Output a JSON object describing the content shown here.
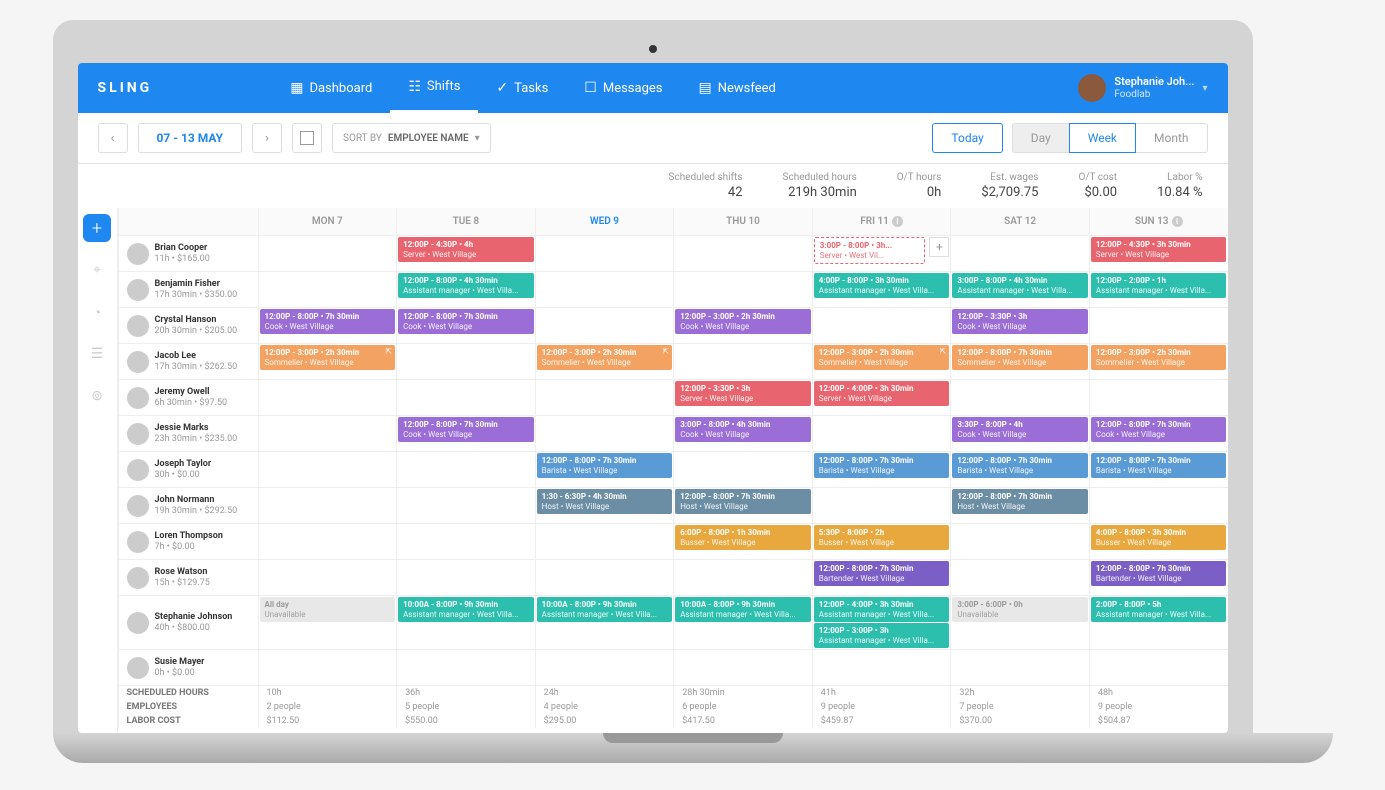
{
  "brand": "SLING",
  "nav": [
    {
      "label": "Dashboard",
      "icon": "▦"
    },
    {
      "label": "Shifts",
      "icon": "☷",
      "active": true
    },
    {
      "label": "Tasks",
      "icon": "✓"
    },
    {
      "label": "Messages",
      "icon": "☐"
    },
    {
      "label": "Newsfeed",
      "icon": "▤"
    }
  ],
  "user": {
    "name": "Stephanie Joh...",
    "org": "Foodlab"
  },
  "dateRange": "07 - 13 MAY",
  "sort": {
    "label": "SORT BY",
    "value": "EMPLOYEE NAME"
  },
  "viewButtons": {
    "today": "Today",
    "day": "Day",
    "week": "Week",
    "month": "Month"
  },
  "stats": [
    {
      "label": "Scheduled shifts",
      "value": "42"
    },
    {
      "label": "Scheduled hours",
      "value": "219h 30min"
    },
    {
      "label": "O/T hours",
      "value": "0h"
    },
    {
      "label": "Est. wages",
      "value": "$2,709.75"
    },
    {
      "label": "O/T cost",
      "value": "$0.00"
    },
    {
      "label": "Labor %",
      "value": "10.84 %"
    }
  ],
  "days": [
    {
      "label": "MON 7"
    },
    {
      "label": "TUE 8"
    },
    {
      "label": "WED 9",
      "today": true
    },
    {
      "label": "THU 10"
    },
    {
      "label": "FRI 11",
      "info": true
    },
    {
      "label": "SAT 12"
    },
    {
      "label": "SUN 13",
      "info": true
    }
  ],
  "employees": [
    {
      "name": "Brian Cooper",
      "meta": "11h • $165.00",
      "shifts": {
        "1": [
          {
            "c": "red",
            "t": "12:00P - 4:30P • 4h",
            "r": "Server • West Village"
          }
        ],
        "4": [
          {
            "c": "outlined",
            "t": "3:00P - 8:00P • 3h...",
            "r": "Server • West Vil...",
            "add": true
          }
        ],
        "6": [
          {
            "c": "red",
            "t": "12:00P - 4:30P • 3h 30min",
            "r": "Server • West Village"
          }
        ]
      }
    },
    {
      "name": "Benjamin Fisher",
      "meta": "17h 30min • $350.00",
      "shifts": {
        "1": [
          {
            "c": "teal",
            "t": "12:00P - 8:00P • 4h 30min",
            "r": "Assistant manager • West Villa..."
          }
        ],
        "4": [
          {
            "c": "teal",
            "t": "4:00P - 8:00P • 3h 30min",
            "r": "Assistant manager • West Villa..."
          }
        ],
        "5": [
          {
            "c": "teal",
            "t": "3:00P - 8:00P • 4h 30min",
            "r": "Assistant manager • West Villa..."
          }
        ],
        "6": [
          {
            "c": "teal",
            "t": "12:00P - 2:00P • 1h",
            "r": "Assistant manager • West Villa..."
          }
        ]
      }
    },
    {
      "name": "Crystal Hanson",
      "meta": "20h 30min • $205.00",
      "shifts": {
        "0": [
          {
            "c": "purple",
            "t": "12:00P - 8:00P • 7h 30min",
            "r": "Cook • West Village"
          }
        ],
        "1": [
          {
            "c": "purple",
            "t": "12:00P - 8:00P • 7h 30min",
            "r": "Cook • West Village"
          }
        ],
        "3": [
          {
            "c": "purple",
            "t": "12:00P - 3:00P • 2h 30min",
            "r": "Cook • West Village"
          }
        ],
        "5": [
          {
            "c": "purple",
            "t": "12:00P - 3:30P • 3h",
            "r": "Cook • West Village"
          }
        ]
      }
    },
    {
      "name": "Jacob Lee",
      "meta": "17h 30min • $262.50",
      "shifts": {
        "0": [
          {
            "c": "orange",
            "t": "12:00P - 3:00P • 2h 30min",
            "r": "Sommelier • West Village",
            "ext": true
          }
        ],
        "2": [
          {
            "c": "orange",
            "t": "12:00P - 3:00P • 2h 30min",
            "r": "Sommelier • West Village",
            "ext": true
          }
        ],
        "4": [
          {
            "c": "orange",
            "t": "12:00P - 3:00P • 2h 30min",
            "r": "Sommelier • West Village",
            "ext": true
          }
        ],
        "5": [
          {
            "c": "orange",
            "t": "12:00P - 8:00P • 7h 30min",
            "r": "Sommelier • West Village"
          }
        ],
        "6": [
          {
            "c": "orange",
            "t": "12:00P - 3:00P • 2h 30min",
            "r": "Sommelier • West Village"
          }
        ]
      }
    },
    {
      "name": "Jeremy Owell",
      "meta": "6h 30min • $97.50",
      "shifts": {
        "3": [
          {
            "c": "red",
            "t": "12:00P - 3:30P • 3h",
            "r": "Server • West Village"
          }
        ],
        "4": [
          {
            "c": "red",
            "t": "12:00P - 4:00P • 3h 30min",
            "r": "Server • West Village"
          }
        ]
      }
    },
    {
      "name": "Jessie Marks",
      "meta": "23h 30min • $235.00",
      "shifts": {
        "1": [
          {
            "c": "purple",
            "t": "12:00P - 8:00P • 7h 30min",
            "r": "Cook • West Village"
          }
        ],
        "3": [
          {
            "c": "purple",
            "t": "3:00P - 8:00P • 4h 30min",
            "r": "Cook • West Village"
          }
        ],
        "5": [
          {
            "c": "purple",
            "t": "3:30P - 8:00P • 4h",
            "r": "Cook • West Village"
          }
        ],
        "6": [
          {
            "c": "purple",
            "t": "12:00P - 8:00P • 7h 30min",
            "r": "Cook • West Village"
          }
        ]
      }
    },
    {
      "name": "Joseph Taylor",
      "meta": "30h • $0.00",
      "shifts": {
        "2": [
          {
            "c": "blue",
            "t": "12:00P - 8:00P • 7h 30min",
            "r": "Barista • West Village"
          }
        ],
        "4": [
          {
            "c": "blue",
            "t": "12:00P - 8:00P • 7h 30min",
            "r": "Barista • West Village"
          }
        ],
        "5": [
          {
            "c": "blue",
            "t": "12:00P - 8:00P • 7h 30min",
            "r": "Barista • West Village"
          }
        ],
        "6": [
          {
            "c": "blue",
            "t": "12:00P - 8:00P • 7h 30min",
            "r": "Barista • West Village"
          }
        ]
      }
    },
    {
      "name": "John Normann",
      "meta": "19h 30min • $292.50",
      "shifts": {
        "2": [
          {
            "c": "slate",
            "t": "1:30 - 6:30P • 4h 30min",
            "r": "Host • West Village"
          }
        ],
        "3": [
          {
            "c": "slate",
            "t": "12:00P - 8:00P • 7h 30min",
            "r": "Host • West Village"
          }
        ],
        "5": [
          {
            "c": "slate",
            "t": "12:00P - 8:00P • 7h 30min",
            "r": "Host • West Village"
          }
        ]
      }
    },
    {
      "name": "Loren Thompson",
      "meta": "7h • $0.00",
      "shifts": {
        "3": [
          {
            "c": "gold",
            "t": "6:00P - 8:00P • 1h 30min",
            "r": "Busser • West Village"
          }
        ],
        "4": [
          {
            "c": "gold",
            "t": "5:30P - 8:00P • 2h",
            "r": "Busser • West Village"
          }
        ],
        "6": [
          {
            "c": "gold",
            "t": "4:00P - 8:00P • 3h 30min",
            "r": "Busser • West Village"
          }
        ]
      }
    },
    {
      "name": "Rose Watson",
      "meta": "15h • $129.75",
      "shifts": {
        "4": [
          {
            "c": "violet",
            "t": "12:00P - 8:00P • 7h 30min",
            "r": "Bartender • West Village"
          }
        ],
        "6": [
          {
            "c": "violet",
            "t": "12:00P - 8:00P • 7h 30min",
            "r": "Bartender • West Village"
          }
        ]
      }
    },
    {
      "name": "Stephanie Johnson",
      "meta": "40h • $800.00",
      "shifts": {
        "0": [
          {
            "c": "gray",
            "t": "All day",
            "r": "Unavailable"
          }
        ],
        "1": [
          {
            "c": "teal",
            "t": "10:00A - 8:00P • 9h 30min",
            "r": "Assistant manager • West Villa..."
          }
        ],
        "2": [
          {
            "c": "teal",
            "t": "10:00A - 8:00P • 9h 30min",
            "r": "Assistant manager • West Villa..."
          }
        ],
        "3": [
          {
            "c": "teal",
            "t": "10:00A - 8:00P • 9h 30min",
            "r": "Assistant manager • West Villa..."
          }
        ],
        "4": [
          {
            "c": "teal",
            "t": "12:00P - 4:00P • 3h 30min",
            "r": "Assistant manager • West Villa..."
          },
          {
            "c": "teal",
            "t": "12:00P - 3:00P • 3h",
            "r": "Assistant manager • West Villa..."
          }
        ],
        "5": [
          {
            "c": "gray",
            "t": "3:00P - 6:00P • 0h",
            "r": "Unavailable"
          }
        ],
        "6": [
          {
            "c": "teal",
            "t": "2:00P - 8:00P • 5h",
            "r": "Assistant manager • West Villa..."
          }
        ]
      }
    },
    {
      "name": "Susie Mayer",
      "meta": "0h • $0.00",
      "shifts": {}
    }
  ],
  "footer": {
    "rows": [
      {
        "label": "SCHEDULED HOURS",
        "vals": [
          "10h",
          "36h",
          "24h",
          "28h 30min",
          "41h",
          "32h",
          "48h"
        ]
      },
      {
        "label": "EMPLOYEES",
        "vals": [
          "2 people",
          "5 people",
          "4 people",
          "6 people",
          "9 people",
          "7 people",
          "9 people"
        ]
      },
      {
        "label": "LABOR COST",
        "vals": [
          "$112.50",
          "$550.00",
          "$295.00",
          "$417.50",
          "$459.87",
          "$370.00",
          "$504.87"
        ]
      }
    ]
  }
}
